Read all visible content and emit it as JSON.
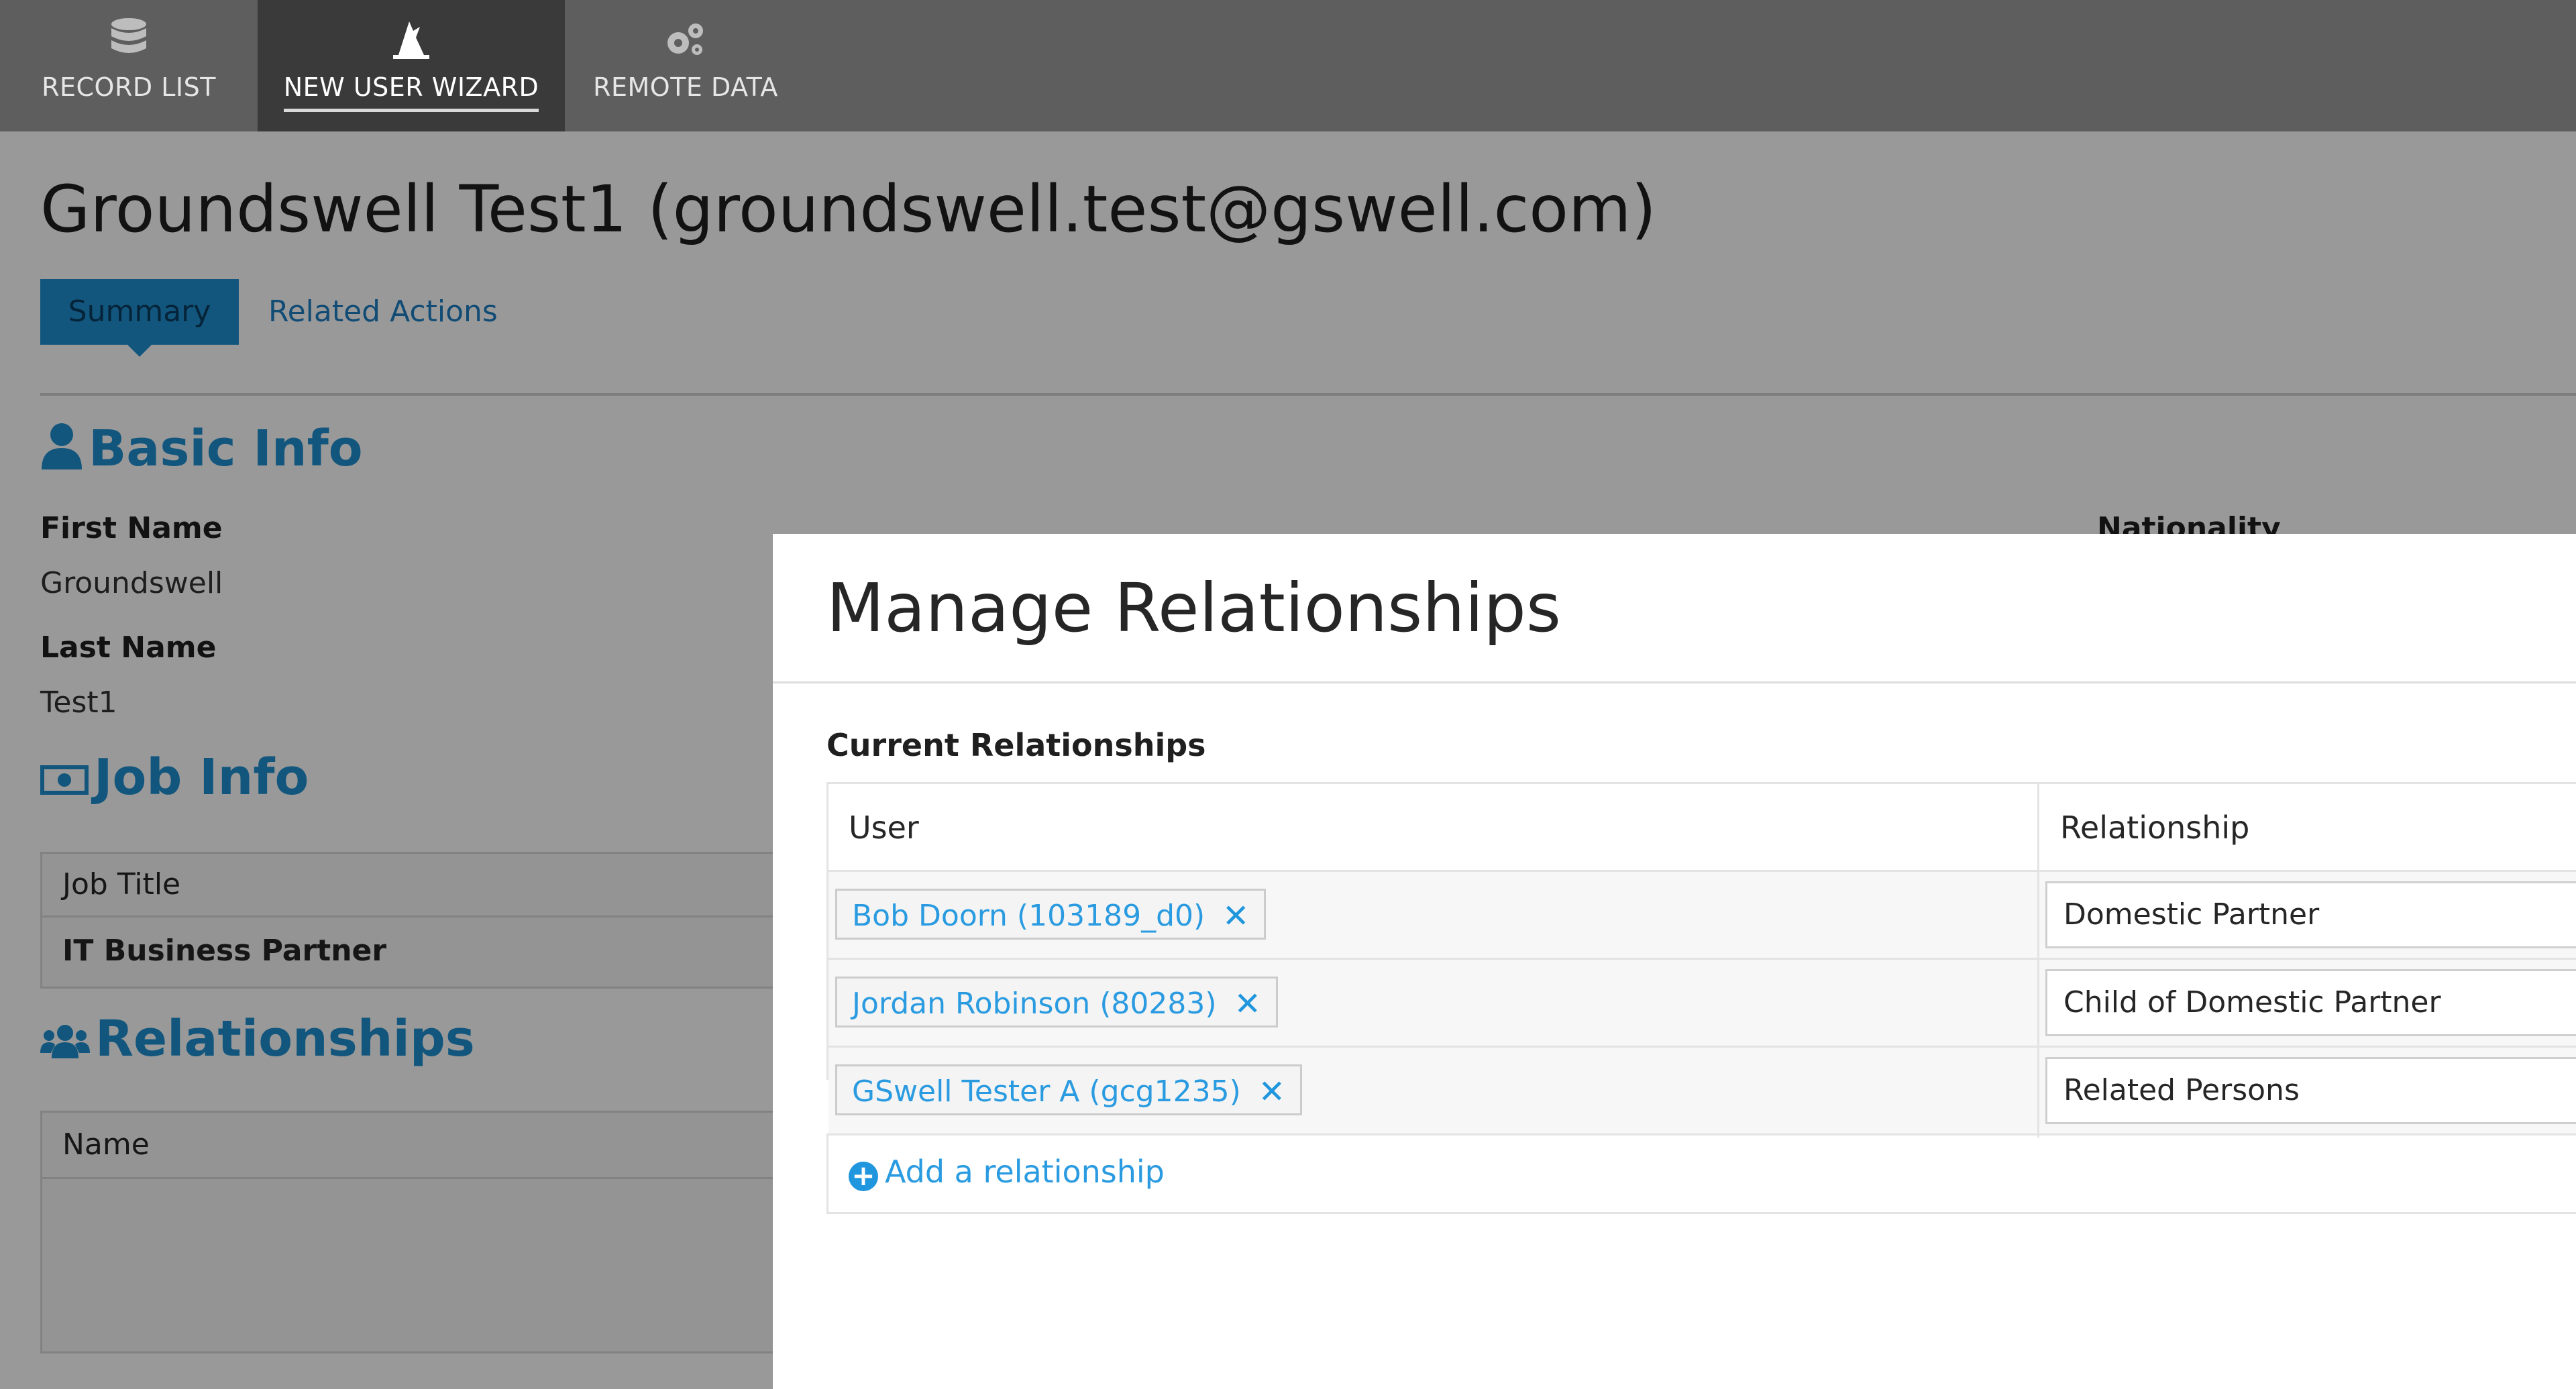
{
  "nav": {
    "tabs": [
      {
        "label": "RECORD LIST",
        "icon": "database-icon"
      },
      {
        "label": "NEW USER WIZARD",
        "icon": "wizard-hat-icon",
        "active": true
      },
      {
        "label": "REMOTE DATA",
        "icon": "gears-icon"
      }
    ]
  },
  "page": {
    "title": "Groundswell Test1 (groundswell.test@gswell.com)",
    "subtabs": {
      "summary": "Summary",
      "related": "Related Actions"
    }
  },
  "basic_info": {
    "heading": "Basic Info",
    "first_name_label": "First Name",
    "first_name_value": "Groundswell",
    "last_name_label": "Last Name",
    "last_name_value": "Test1",
    "nationality_label": "Nationality"
  },
  "job_info": {
    "heading": "Job Info",
    "job_title_label": "Job Title",
    "job_title_value": "IT Business Partner"
  },
  "relationships_section": {
    "heading": "Relationships",
    "name_col": "Name"
  },
  "modal": {
    "title": "Manage Relationships",
    "current_label": "Current Relationships",
    "col_user": "User",
    "col_relationship": "Relationship",
    "rows": [
      {
        "user": "Bob Doorn (103189_d0)",
        "relationship": "Domestic Partner"
      },
      {
        "user": "Jordan Robinson (80283)",
        "relationship": "Child of Domestic Partner"
      },
      {
        "user": "GSwell Tester A (gcg1235)",
        "relationship": "Related Persons"
      }
    ],
    "add_label": "Add a relationship",
    "remove_glyph": "✕",
    "add_glyph": "+"
  },
  "colors": {
    "accent": "#1e8fd1",
    "nav_bg": "#5e5e5e",
    "nav_active_bg": "#3a3a3a",
    "link": "#2a9be0"
  }
}
